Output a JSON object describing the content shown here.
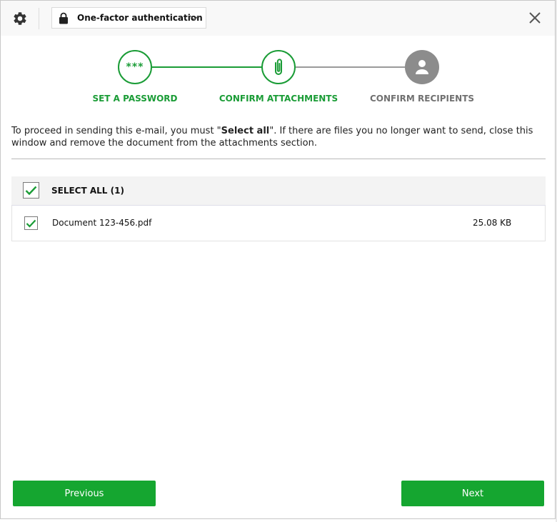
{
  "header": {
    "settings_icon": "gear-icon",
    "auth_mode": "One-factor authentication",
    "lock_icon": "lock-icon",
    "dropdown_icon": "chevron-down-icon",
    "close_icon": "close-icon"
  },
  "stepper": {
    "steps": [
      {
        "label": "SET A PASSWORD",
        "symbol": "***",
        "state": "complete"
      },
      {
        "label": "CONFIRM ATTACHMENTS",
        "icon": "paperclip-icon",
        "state": "active"
      },
      {
        "label": "CONFIRM RECIPIENTS",
        "icon": "user-icon",
        "state": "pending"
      }
    ]
  },
  "instructions": {
    "before": "To proceed in sending this e-mail, you must \"",
    "bold": "Select all",
    "after": "\". If there are files you no longer want to send, close this window and remove the document from the attachments section."
  },
  "attachments": {
    "select_all_label": "SELECT ALL (1)",
    "files": [
      {
        "name": "Document 123-456.pdf",
        "size": "25.08 KB",
        "checked": true
      }
    ]
  },
  "footer": {
    "previous_label": "Previous",
    "next_label": "Next"
  },
  "colors": {
    "accent_green": "#1a9c36",
    "button_green": "#15a630",
    "pending_gray": "#8c8c8c"
  }
}
